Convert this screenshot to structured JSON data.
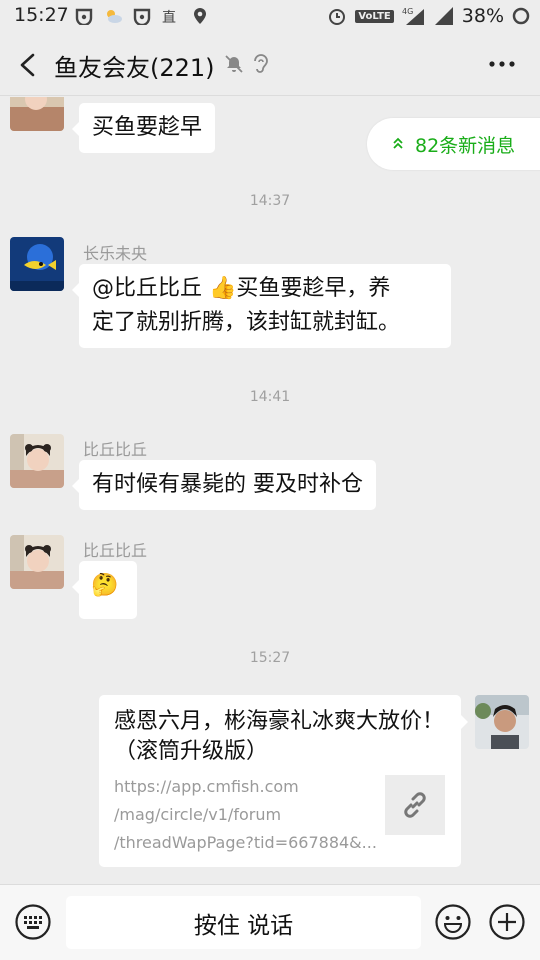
{
  "status_bar": {
    "time": "15:27",
    "volte": "VoLTE",
    "network": "4G",
    "battery": "38%"
  },
  "header": {
    "title": "鱼友会友(221)",
    "icons": [
      "back-icon",
      "mute-icon",
      "ear-icon",
      "more-icon"
    ]
  },
  "new_messages": {
    "label": "82条新消息"
  },
  "messages": [
    {
      "sender": "",
      "text": "买鱼要趁早"
    },
    {
      "type": "time",
      "text": "14:37"
    },
    {
      "sender": "长乐未央",
      "text_line1": "@比丘比丘 👍买鱼要趁早，养",
      "text_line2": "定了就别折腾，该封缸就封缸。"
    },
    {
      "type": "time",
      "text": "14:41"
    },
    {
      "sender": "比丘比丘",
      "text": "有时候有暴毙的 要及时补仓"
    },
    {
      "sender": "比丘比丘",
      "text": "🤔"
    },
    {
      "type": "time",
      "text": "15:27"
    }
  ],
  "link_card": {
    "title": "感恩六月，彬海豪礼冰爽大放价！（滚筒升级版）",
    "url_lines": [
      "https://app.cmfish.com",
      "/mag/circle/v1/forum",
      "/threadWapPage?tid=667884&..."
    ]
  },
  "input_bar": {
    "hold_to_talk": "按住 说话"
  },
  "colors": {
    "accent_green": "#1aad19",
    "background": "#ededed",
    "bubble": "#ffffff"
  }
}
